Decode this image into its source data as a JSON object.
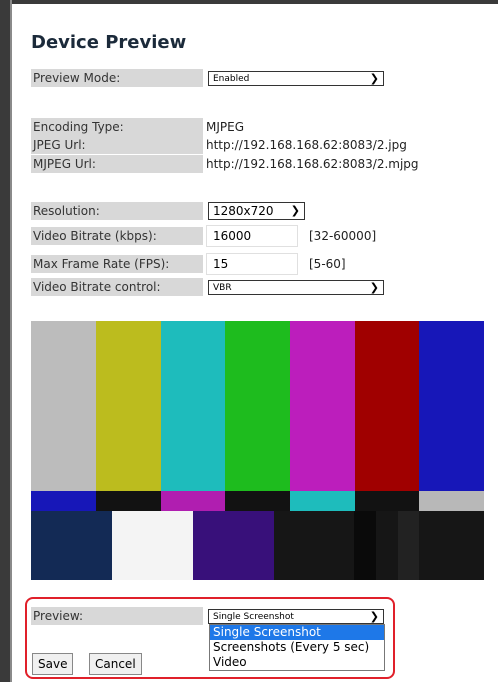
{
  "page": {
    "title": "Device Preview"
  },
  "preview_mode": {
    "label": "Preview Mode:",
    "value": "Enabled"
  },
  "encoding": {
    "type_label": "Encoding Type:",
    "type_value": "MJPEG",
    "jpeg_label": "JPEG Url:",
    "jpeg_value": "http://192.168.168.62:8083/2.jpg",
    "mjpeg_label": "MJPEG Url:",
    "mjpeg_value": "http://192.168.168.62:8083/2.mjpg"
  },
  "video": {
    "resolution_label": "Resolution:",
    "resolution_value": "1280x720",
    "bitrate_label": "Video Bitrate (kbps):",
    "bitrate_value": "16000",
    "bitrate_range": "[32-60000]",
    "framerate_label": "Max Frame Rate (FPS):",
    "framerate_value": "15",
    "framerate_range": "[5-60]",
    "control_label": "Video Bitrate control:",
    "control_value": "VBR"
  },
  "preview": {
    "label": "Preview:",
    "selected": "Single Screenshot",
    "options": [
      "Single Screenshot",
      "Screenshots (Every 5 sec)",
      "Video"
    ]
  },
  "buttons": {
    "save": "Save",
    "cancel": "Cancel"
  },
  "icons": {
    "dropdown": "chevron-down-icon"
  },
  "colors": {
    "highlight_border": "#e0202a",
    "selected_option": "#1e78e8"
  }
}
